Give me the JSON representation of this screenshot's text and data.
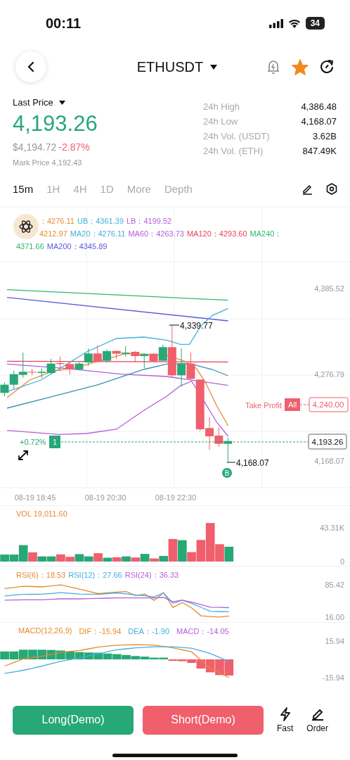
{
  "status_bar": {
    "time": "00:11",
    "battery": "34"
  },
  "header": {
    "symbol": "ETHUSDT",
    "favorite": true
  },
  "price": {
    "label": "Last Price",
    "last": "4,193.26",
    "usd": "$4,194.72",
    "change": "-2.87%",
    "mark": "Mark Price 4,192.43"
  },
  "stats": [
    {
      "label": "24h High",
      "value": "4,386.48"
    },
    {
      "label": "24h Low",
      "value": "4,168.07"
    },
    {
      "label": "24h Vol. (USDT)",
      "value": "3.62B"
    },
    {
      "label": "24h Vol. (ETH)",
      "value": "847.49K"
    }
  ],
  "intervals": [
    {
      "label": "15m",
      "selected": true
    },
    {
      "label": "1H",
      "selected": false
    },
    {
      "label": "4H",
      "selected": false
    },
    {
      "label": "1D",
      "selected": false
    },
    {
      "label": "More",
      "selected": false
    },
    {
      "label": "Depth",
      "selected": false
    }
  ],
  "legend_lines": [
    [
      {
        "text": "：4276.11",
        "color": "#e8892f"
      },
      {
        "text": "UB：4361.39",
        "color": "#44aee0"
      },
      {
        "text": "LB：4199.52",
        "color": "#b45fd8"
      }
    ],
    [
      {
        "text": "4212.97",
        "color": "#e8892f"
      },
      {
        "text": "MA20：4276.11",
        "color": "#44aee0"
      },
      {
        "text": "MA60：4263.73",
        "color": "#b45fd8"
      },
      {
        "text": "MA120：4293.60",
        "color": "#e8415a"
      },
      {
        "text": "MA240：",
        "color": "#2fb86a"
      }
    ],
    [
      {
        "text": "4371.66",
        "color": "#2fb86a"
      },
      {
        "text": "MA200：4345.89",
        "color": "#5b5bd6"
      }
    ]
  ],
  "price_chart": {
    "y_labels": [
      "4,385.52",
      "4,276.79",
      "4,168.07"
    ],
    "time_labels": [
      "08-19 18:45",
      "08-19 20:30",
      "08-19 22:30"
    ],
    "high_label": "4,339.77",
    "low_label": "4,168.07",
    "buy_marker": "B",
    "position": {
      "pnl": "+0.72%",
      "qty": "1"
    },
    "last_price_tag": "4,193.26",
    "take_profit": {
      "label": "Take Profit",
      "scope": "All",
      "price": "4,240.00"
    }
  },
  "volume": {
    "legend": "VOL 19,011.60",
    "axis_labels": [
      "43.31K",
      "0"
    ]
  },
  "rsi": {
    "legend": [
      {
        "text": "RSI(6)：18.53",
        "color": "#e8892f"
      },
      {
        "text": "RSI(12)：27.66",
        "color": "#44aee0"
      },
      {
        "text": "RSI(24)：36.33",
        "color": "#b45fd8"
      }
    ],
    "axis_labels": [
      "85.42",
      "16.00"
    ]
  },
  "macd": {
    "legend": [
      {
        "text": "MACD(12,26,9)",
        "color": "#e8892f"
      },
      {
        "text": "DIF：-15.94",
        "color": "#e8892f"
      },
      {
        "text": "DEA：-1.90",
        "color": "#44aee0"
      },
      {
        "text": "MACD：-14.05",
        "color": "#b45fd8"
      }
    ],
    "axis_labels": [
      "15.94",
      "-15.94"
    ]
  },
  "actions": [
    {
      "label": "Long(Demo)",
      "kind": "long"
    },
    {
      "label": "Short(Demo)",
      "kind": "short"
    }
  ],
  "tools": [
    {
      "label": "Fast",
      "kind": "fast"
    },
    {
      "label": "Order",
      "kind": "order"
    }
  ]
}
